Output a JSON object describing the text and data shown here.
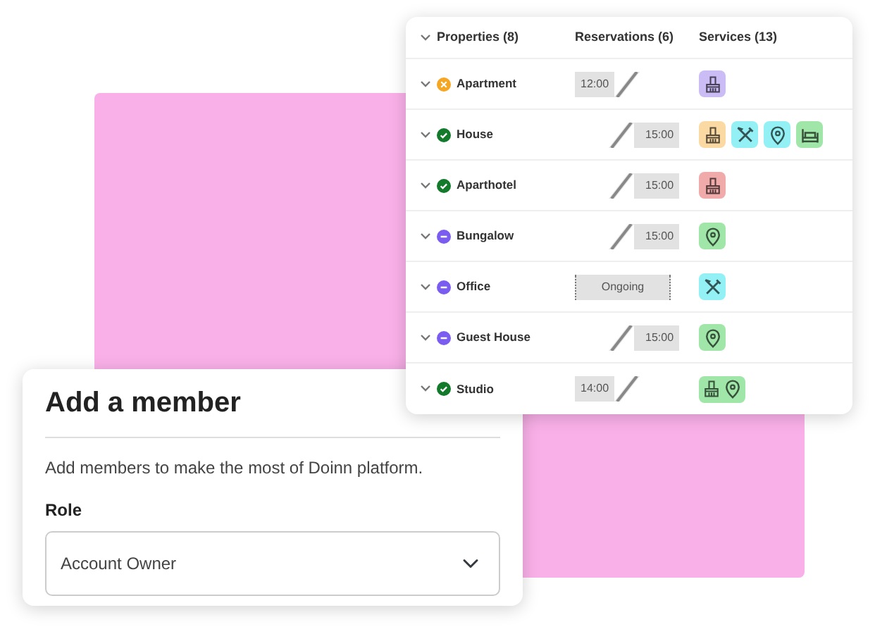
{
  "table": {
    "columns": [
      {
        "label": "Properties (8)"
      },
      {
        "label": "Reservations (6)"
      },
      {
        "label": "Services (13)"
      }
    ],
    "rows": [
      {
        "name": "Apartment",
        "status": {
          "kind": "warning"
        },
        "reservation": {
          "kind": "start",
          "text": "12:00"
        },
        "services": [
          {
            "color": "#cbbcf6",
            "icons": [
              {
                "kind": "broom"
              }
            ]
          }
        ]
      },
      {
        "name": "House",
        "status": {
          "kind": "ok"
        },
        "reservation": {
          "kind": "end",
          "text": "15:00"
        },
        "services": [
          {
            "color": "#fbd9a2",
            "icons": [
              {
                "kind": "broom"
              }
            ]
          },
          {
            "color": "#93f0f4",
            "icons": [
              {
                "kind": "tools"
              }
            ]
          },
          {
            "color": "#93f0f4",
            "icons": [
              {
                "kind": "pin"
              }
            ]
          },
          {
            "color": "#9fe6a8",
            "icons": [
              {
                "kind": "bed"
              }
            ]
          }
        ]
      },
      {
        "name": "Aparthotel",
        "status": {
          "kind": "ok"
        },
        "reservation": {
          "kind": "end",
          "text": "15:00"
        },
        "services": [
          {
            "color": "#f1aaaa",
            "icons": [
              {
                "kind": "broom"
              }
            ]
          }
        ]
      },
      {
        "name": "Bungalow",
        "status": {
          "kind": "blocked"
        },
        "reservation": {
          "kind": "end",
          "text": "15:00"
        },
        "services": [
          {
            "color": "#9fe6a8",
            "icons": [
              {
                "kind": "pin"
              }
            ]
          }
        ]
      },
      {
        "name": "Office",
        "status": {
          "kind": "blocked"
        },
        "reservation": {
          "kind": "ongoing",
          "text": "Ongoing"
        },
        "services": [
          {
            "color": "#93f0f4",
            "icons": [
              {
                "kind": "tools"
              }
            ]
          }
        ]
      },
      {
        "name": "Guest House",
        "status": {
          "kind": "blocked"
        },
        "reservation": {
          "kind": "end",
          "text": "15:00"
        },
        "services": [
          {
            "color": "#9fe6a8",
            "icons": [
              {
                "kind": "pin"
              }
            ]
          }
        ]
      },
      {
        "name": "Studio",
        "status": {
          "kind": "ok"
        },
        "reservation": {
          "kind": "start",
          "text": "14:00"
        },
        "services": [
          {
            "color": "#9fe6a8",
            "icons": [
              {
                "kind": "broom"
              },
              {
                "kind": "pin"
              }
            ]
          }
        ]
      }
    ]
  },
  "member_card": {
    "title": "Add a member",
    "description": "Add members to make the most of Doinn platform.",
    "role_label": "Role",
    "role_value": "Account Owner"
  }
}
